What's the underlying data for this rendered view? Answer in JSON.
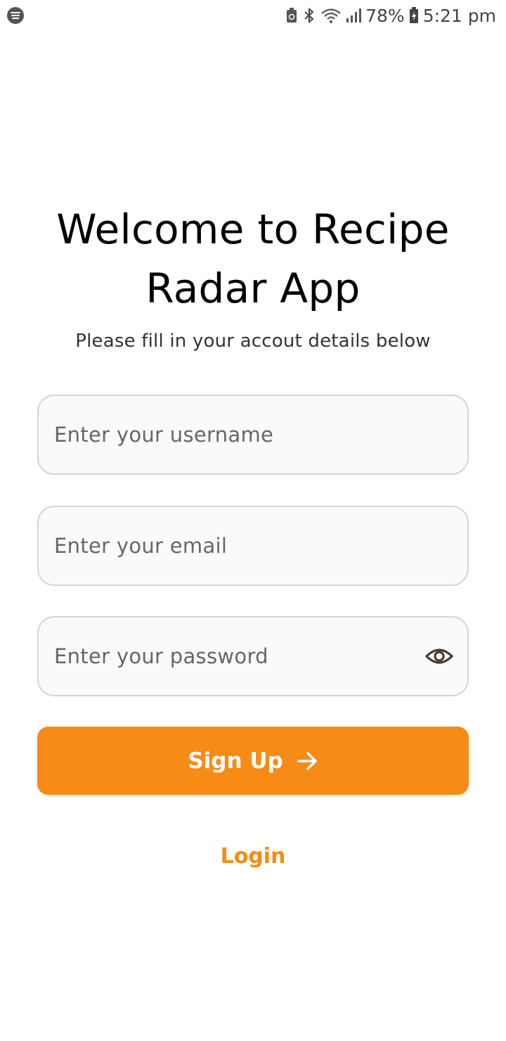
{
  "status_bar": {
    "battery": "78%",
    "time": "5:21 pm",
    "icons": [
      "spotify-icon",
      "recycle-icon",
      "bluetooth-icon",
      "wifi-icon",
      "signal-icon",
      "battery-icon"
    ]
  },
  "page": {
    "title": "Welcome to Recipe Radar App",
    "subtitle": "Please fill in your accout details below"
  },
  "form": {
    "username_placeholder": "Enter your username",
    "email_placeholder": "Enter your email",
    "password_placeholder": "Enter your password",
    "signup_label": "Sign Up",
    "login_label": "Login"
  },
  "colors": {
    "accent": "#f68b16",
    "field_border": "#d5d5d5",
    "field_bg": "#fafafa"
  }
}
